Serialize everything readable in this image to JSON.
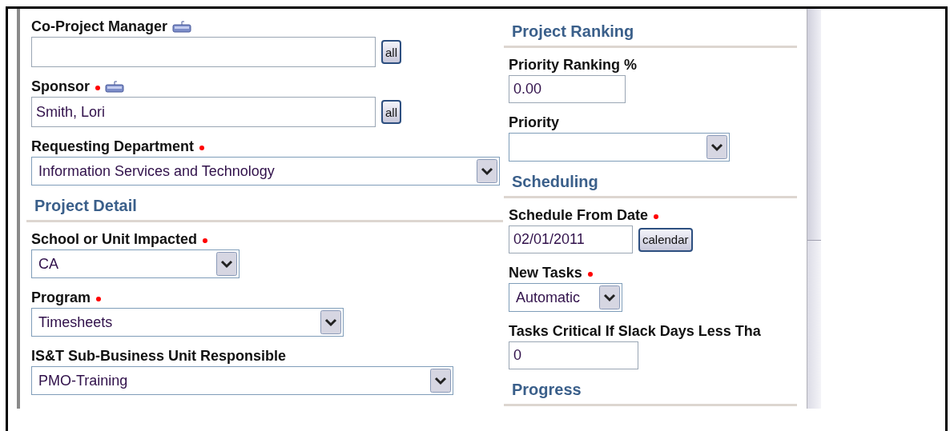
{
  "left_column": [
    {
      "kind": "lookup",
      "label": "Co-Project Manager",
      "required": false,
      "keyboard_icon": true,
      "button": "all"
    },
    {
      "kind": "lookup",
      "label": "Sponsor",
      "required": true,
      "keyboard_icon": true,
      "value": "Smith, Lori",
      "button": "all"
    },
    {
      "kind": "select",
      "label": "Requesting Department",
      "required": true,
      "value": "Information Services and Technology"
    },
    {
      "kind": "heading",
      "label": "Project Detail"
    },
    {
      "kind": "select",
      "label": "School or Unit Impacted",
      "required": true,
      "value": "CA"
    },
    {
      "kind": "select",
      "label": "Program",
      "required": true,
      "value": "Timesheets"
    },
    {
      "kind": "select",
      "label": "IS&T Sub-Business Unit Responsible",
      "required": false,
      "value": "PMO-Training"
    }
  ],
  "right_column": [
    {
      "kind": "heading",
      "label": "Project Ranking"
    },
    {
      "kind": "text",
      "label": "Priority Ranking %",
      "required": false,
      "value": "0.00"
    },
    {
      "kind": "select",
      "label": "Priority",
      "required": false
    },
    {
      "kind": "heading",
      "label": "Scheduling"
    },
    {
      "kind": "date",
      "label": "Schedule From Date",
      "required": true,
      "value": "02/01/2011",
      "button": "calendar"
    },
    {
      "kind": "select",
      "label": "New Tasks",
      "required": true,
      "value": "Automatic"
    },
    {
      "kind": "text",
      "label": "Tasks Critical If Slack Days Less Tha",
      "required": false,
      "value": "0"
    },
    {
      "kind": "heading",
      "label": "Progress"
    }
  ]
}
